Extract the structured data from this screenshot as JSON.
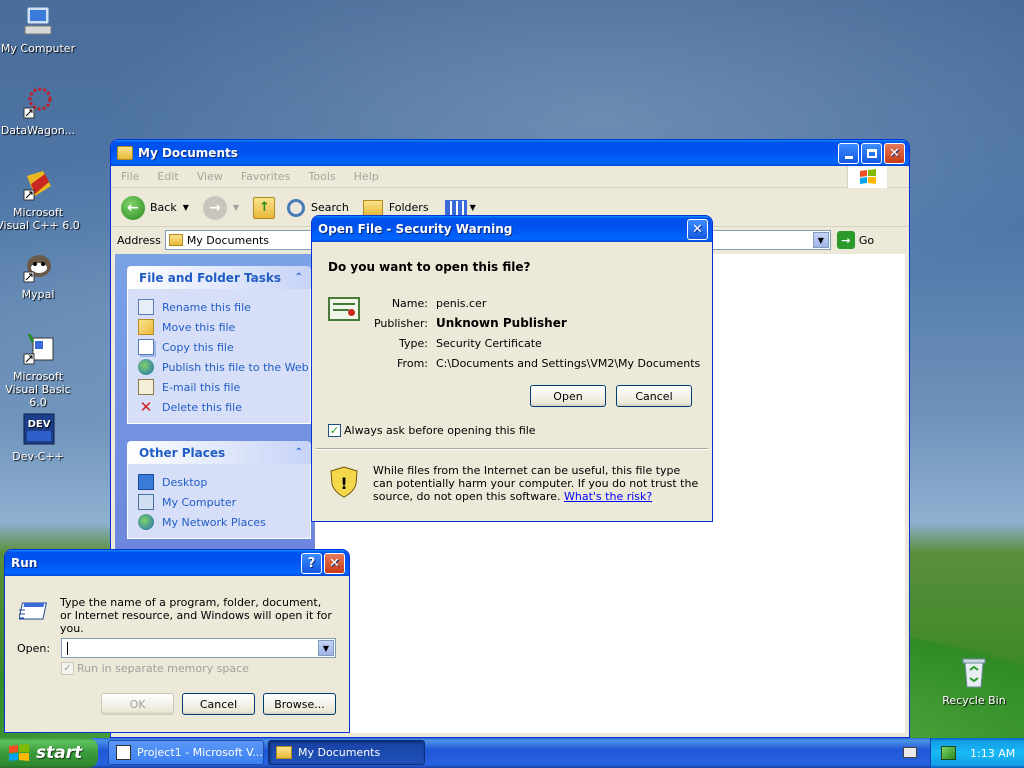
{
  "desktop": {
    "icons": [
      {
        "label": "My Computer",
        "icon": "my-computer-icon"
      },
      {
        "label": "DataWagon...",
        "icon": "datawagon-shortcut-icon"
      },
      {
        "label": "Microsoft Visual C++ 6.0",
        "icon": "visual-cpp-icon"
      },
      {
        "label": "Mypal",
        "icon": "mypal-icon"
      },
      {
        "label": "Microsoft Visual Basic 6.0",
        "icon": "visual-basic-icon"
      },
      {
        "label": "Dev-C++",
        "icon": "dev-cpp-icon"
      },
      {
        "label": "Recycle Bin",
        "icon": "recycle-bin-icon"
      }
    ]
  },
  "explorer": {
    "title": "My Documents",
    "menu": [
      "File",
      "Edit",
      "View",
      "Favorites",
      "Tools",
      "Help"
    ],
    "toolbar": {
      "back": "Back",
      "search": "Search",
      "folders": "Folders"
    },
    "address": {
      "label": "Address",
      "value": "My Documents",
      "go": "Go"
    },
    "file_tasks": {
      "title": "File and Folder Tasks",
      "items": [
        "Rename this file",
        "Move this file",
        "Copy this file",
        "Publish this file to the Web",
        "E-mail this file",
        "Delete this file"
      ]
    },
    "other_places": {
      "title": "Other Places",
      "items": [
        "Desktop",
        "My Computer",
        "My Network Places"
      ]
    }
  },
  "security_dialog": {
    "title": "Open File - Security Warning",
    "question": "Do you want to open this file?",
    "labels": {
      "name": "Name:",
      "publisher": "Publisher:",
      "type": "Type:",
      "from": "From:"
    },
    "values": {
      "name": "penis.cer",
      "publisher": "Unknown Publisher",
      "type": "Security Certificate",
      "from": "C:\\Documents and Settings\\VM2\\My Documents"
    },
    "open_button": "Open",
    "cancel_button": "Cancel",
    "checkbox_label": "Always ask before opening this file",
    "checkbox_checked": true,
    "warning_text": "While files from the Internet can be useful, this file type can potentially harm your computer. If you do not trust the source, do not open this software.",
    "risk_link": "What's the risk?"
  },
  "run_dialog": {
    "title": "Run",
    "help_button": "?",
    "description": "Type the name of a program, folder, document, or Internet resource, and Windows will open it for you.",
    "open_label": "Open:",
    "open_value": "",
    "memory_checkbox_label": "Run in separate memory space",
    "ok_button": "OK",
    "cancel_button": "Cancel",
    "browse_button": "Browse..."
  },
  "taskbar": {
    "start_label": "start",
    "tasks": [
      {
        "label": "Project1 - Microsoft V...",
        "active": false
      },
      {
        "label": "My Documents",
        "active": true
      }
    ],
    "clock": "1:13 AM"
  },
  "colors": {
    "titlebar_blue": "#0054e3",
    "taskbar_blue": "#245edb",
    "start_green": "#3c9a3c",
    "link_blue": "#215dc6"
  }
}
